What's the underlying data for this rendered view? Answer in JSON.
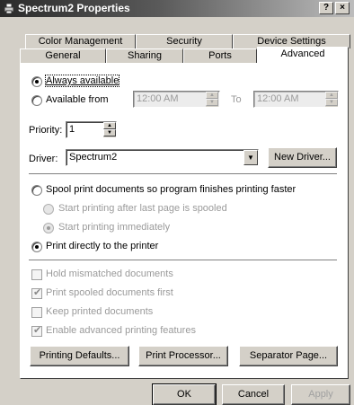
{
  "window": {
    "title": "Spectrum2 Properties",
    "help_button": "?",
    "close_button": "×"
  },
  "tabs": {
    "row1": [
      "Color Management",
      "Security",
      "Device Settings"
    ],
    "row2": [
      "General",
      "Sharing",
      "Ports",
      "Advanced"
    ],
    "active": "Advanced"
  },
  "availability": {
    "always_label": "Always available",
    "from_label": "Available from",
    "from_time": "12:00 AM",
    "to_label": "To",
    "to_time": "12:00 AM"
  },
  "priority": {
    "label": "Priority:",
    "value": "1"
  },
  "driver": {
    "label": "Driver:",
    "value": "Spectrum2",
    "new_driver_button": "New Driver..."
  },
  "spooling": {
    "spool_label": "Spool print documents so program finishes printing faster",
    "after_last_page_label": "Start printing after last page is spooled",
    "immediately_label": "Start printing immediately",
    "direct_label": "Print directly to the printer"
  },
  "options": {
    "hold_mismatched": "Hold mismatched documents",
    "print_spooled_first": "Print spooled documents first",
    "keep_printed": "Keep printed documents",
    "enable_advanced": "Enable advanced printing features"
  },
  "buttons": {
    "printing_defaults": "Printing Defaults...",
    "print_processor": "Print Processor...",
    "separator_page": "Separator Page...",
    "ok": "OK",
    "cancel": "Cancel",
    "apply": "Apply"
  }
}
